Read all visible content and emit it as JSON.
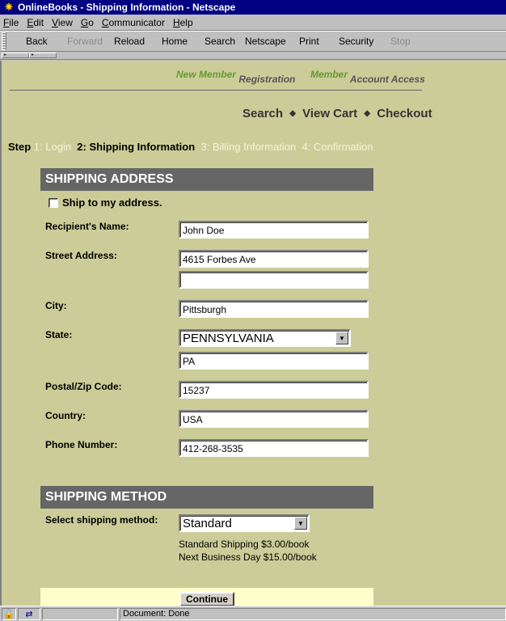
{
  "window": {
    "title": "OnlineBooks - Shipping Information - Netscape"
  },
  "menu": {
    "items": [
      {
        "key": "F",
        "rest": "ile"
      },
      {
        "key": "E",
        "rest": "dit"
      },
      {
        "key": "V",
        "rest": "iew"
      },
      {
        "key": "G",
        "rest": "o"
      },
      {
        "key": "C",
        "rest": "ommunicator"
      },
      {
        "key": "H",
        "rest": "elp"
      }
    ]
  },
  "toolbar": {
    "back": "Back",
    "forward": "Forward",
    "reload": "Reload",
    "home": "Home",
    "search": "Search",
    "netscape": "Netscape",
    "print": "Print",
    "security": "Security",
    "stop": "Stop"
  },
  "member": {
    "new_green": "New Member",
    "new_dark": "Registration",
    "acc_green": "Member",
    "acc_dark": "Account Access"
  },
  "nav": {
    "search": "Search",
    "cart": "View Cart",
    "checkout": "Checkout",
    "sep": "◆"
  },
  "steps": {
    "label": "Step",
    "s1": "1: Login",
    "s2": "2: Shipping Information",
    "s3": "3: Billing Information",
    "s4": "4: Confirmation"
  },
  "address": {
    "heading": "SHIPPING ADDRESS",
    "ship_to_my_address": "Ship to my address.",
    "name_label": "Recipient's Name:",
    "name": "John Doe",
    "street_label": "Street Address:",
    "street1": "4615 Forbes Ave",
    "street2": "",
    "city_label": "City:",
    "city": "Pittsburgh",
    "state_label": "State:",
    "state_select": "PENNSYLVANIA",
    "state_code": "PA",
    "zip_label": "Postal/Zip Code:",
    "zip": "15237",
    "country_label": "Country:",
    "country": "USA",
    "phone_label": "Phone Number:",
    "phone": "412-268-3535"
  },
  "method": {
    "heading": "SHIPPING METHOD",
    "label": "Select shipping method:",
    "selected": "Standard",
    "line1": "Standard Shipping $3.00/book",
    "line2": "Next Business Day $15.00/book"
  },
  "continue": "Continue",
  "status": {
    "text": "Document: Done"
  }
}
